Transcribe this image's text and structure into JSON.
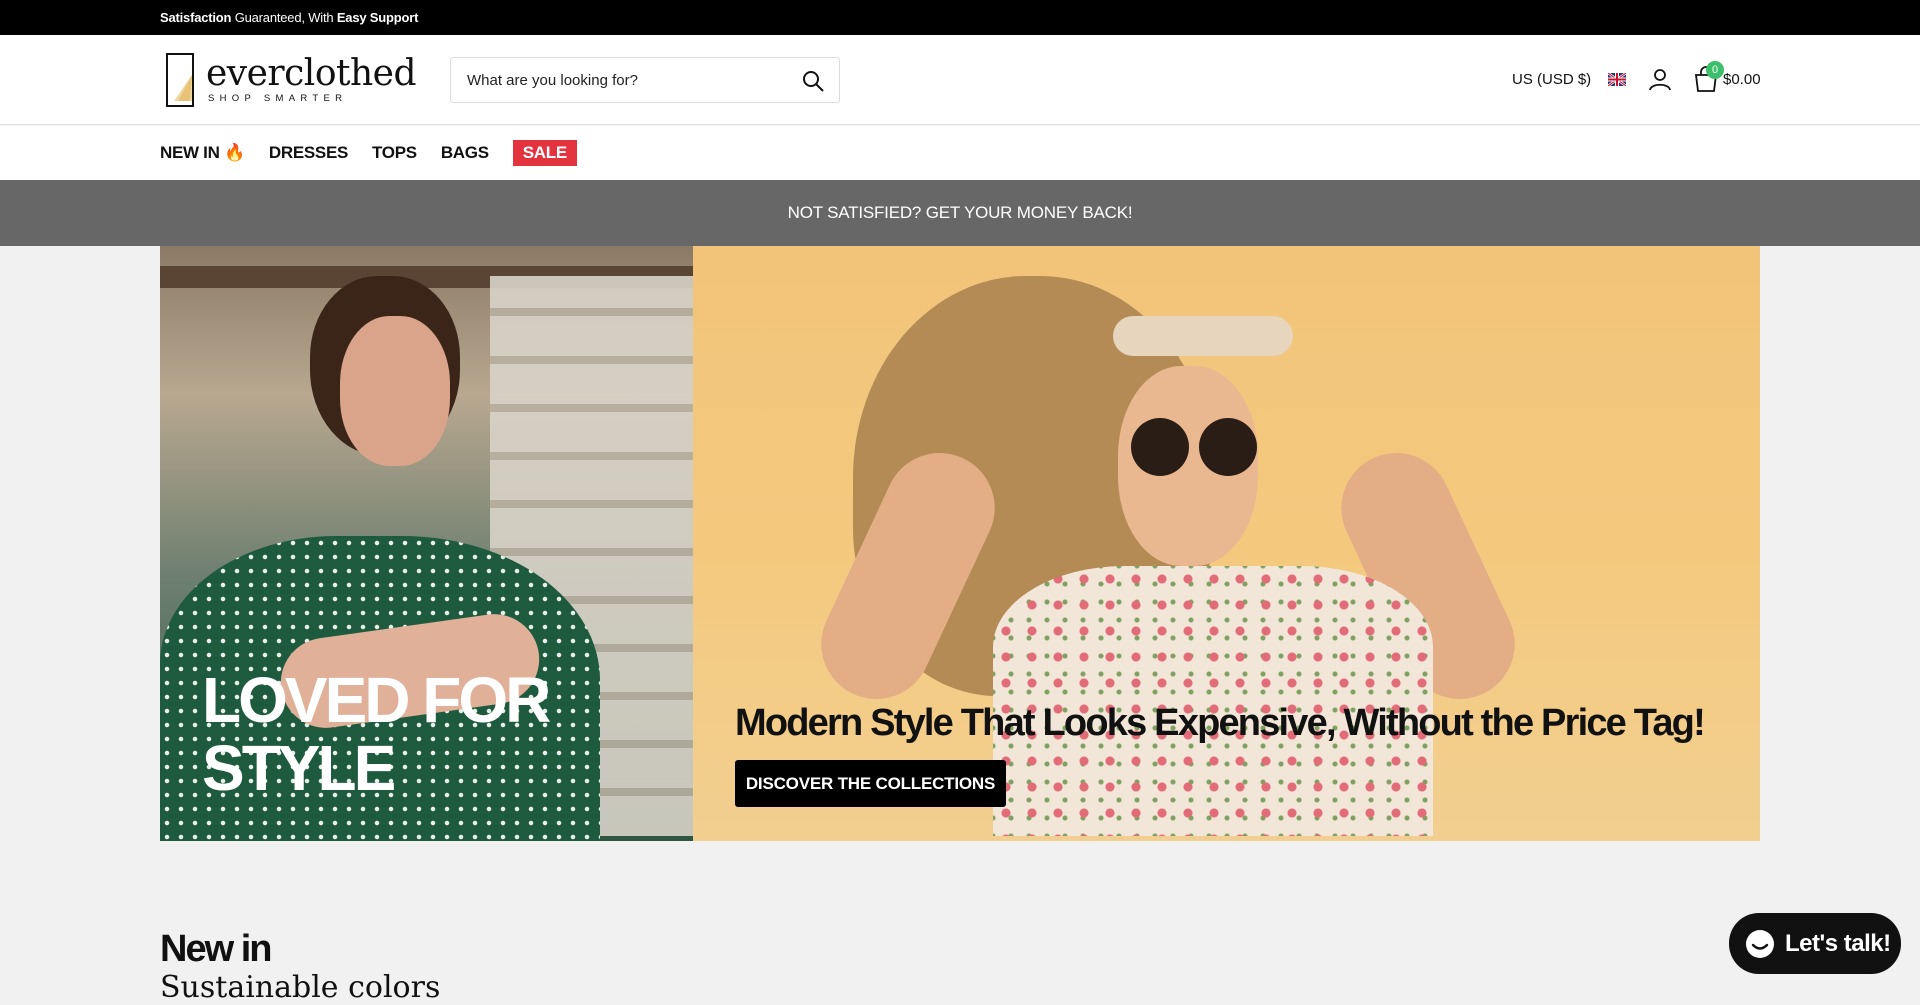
{
  "topbar": {
    "strong_1": "Satisfaction",
    "text": " Guaranteed, With ",
    "strong_2": "Easy Support"
  },
  "header": {
    "logo_name": "everclothed",
    "logo_tagline": "SHOP SMARTER",
    "search_placeholder": "What are you looking for?",
    "currency": "US (USD $)",
    "cart_count": "0",
    "cart_total": "$0.00"
  },
  "nav": {
    "items": [
      "NEW IN 🔥",
      "DRESSES",
      "TOPS",
      "BAGS",
      "SALE"
    ]
  },
  "notice": "NOT SATISFIED? GET YOUR MONEY BACK!",
  "hero": {
    "left_title": "LOVED FOR STYLE",
    "right_title": "Modern Style That Looks Expensive, Without the Price Tag!",
    "cta_label": "DISCOVER THE COLLECTIONS"
  },
  "section": {
    "title": "New in",
    "subtitle": "Sustainable colors"
  },
  "chat": {
    "label": "Let's talk!"
  },
  "colors": {
    "sale": "#e3333f",
    "cart_badge": "#3cbf6a",
    "notice_bg": "#676767",
    "topbar_bg": "#000000"
  },
  "icons": [
    "search-icon",
    "flag-uk-icon",
    "account-icon",
    "cart-icon",
    "chat-bubble-icon"
  ]
}
